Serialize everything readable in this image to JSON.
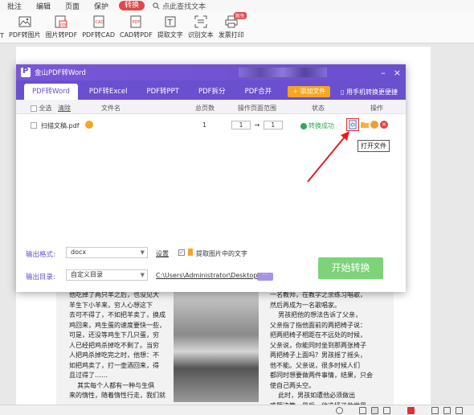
{
  "menubar": {
    "items": [
      "批注",
      "编辑",
      "页面",
      "保护",
      "转换"
    ],
    "active_index": 4,
    "search_label": "点此查找文本"
  },
  "ribbon": {
    "items": [
      {
        "label": "PDF转图片",
        "icon": "image-icon"
      },
      {
        "label": "图片转PDF",
        "icon": "image-to-pdf-icon"
      },
      {
        "label": "PDF转CAD",
        "icon": "pdf-to-cad-icon"
      },
      {
        "label": "CAD转PDF",
        "icon": "cad-to-pdf-icon"
      },
      {
        "label": "提取文字",
        "icon": "extract-text-icon"
      },
      {
        "label": "识别文本",
        "icon": "ocr-icon"
      },
      {
        "label": "发票打印",
        "icon": "printer-icon",
        "badge": "限免"
      }
    ]
  },
  "dialog": {
    "title": "金山PDF转Word",
    "tabs": [
      "PDF转Word",
      "PDF转Excel",
      "PDF转PPT",
      "PDF拆分",
      "PDF合并"
    ],
    "active_tab": 0,
    "add_file_label": "添加文件",
    "phone_label": "用手机转换更便捷",
    "table": {
      "select_all": "全选",
      "clear": "清除",
      "headers": [
        "文件名",
        "总页数",
        "操作页面范围",
        "状态",
        "操作"
      ],
      "rows": [
        {
          "name": "扫描文稿.pdf",
          "pages": "1",
          "from": "1",
          "to": "1",
          "status": "转换成功"
        }
      ]
    },
    "tooltip": "打开文件",
    "output": {
      "format_label": "输出格式:",
      "format_value": "docx",
      "settings_link": "设置",
      "extract_images_label": "提取图片中的文字",
      "dir_label": "输出目录:",
      "dir_value": "自定义目录",
      "dir_path": "C:\\Users\\Administrator\\Desktop\\",
      "start_button": "开始转换"
    }
  },
  "book": {
    "left": "他吃掉了两只羊之后，也没见大\n羊生下小羊来，穷人心想这下\n去可不得了，不如把羊卖了，换成\n鸡回来，鸡生蛋的速度要快一些，\n可是，还没等鸡生下几只蛋，穷\n人已经把鸡杀掉吃不剩了。当穷\n人把鸡杀掉吃完之时，他想：不\n如把鸡卖了，打一壶酒回来，得\n且过得了……\n    其实每个人都有一种与生俱\n来的惰性，随着惰性行走，我们就\n",
    "right": "一名教师，在教学之余练习唱歌，\n然后再成为一名歌唱家。\n    男孩把他的想法告诉了父亲，\n父亲指了指他面前的两把椅子说：\n把两把椅子相距在不远处的时候，\n父亲说，你能同时坐到那两张椅子\n两把椅子上面吗？男孩摇了摇头，\n他不能。父亲说，很多时候人们\n都同时想要做两件事情，结果，只会\n使自己两头空。\n    此时，男孩如遭他必须做出\n难题决策，最后，他选择了做世界\n"
  },
  "colors": {
    "purple": "#6a4fcf",
    "add_file": "#f5a623",
    "start": "#7dd37a",
    "success": "#2daa55",
    "active_menu": "#e0474a"
  }
}
